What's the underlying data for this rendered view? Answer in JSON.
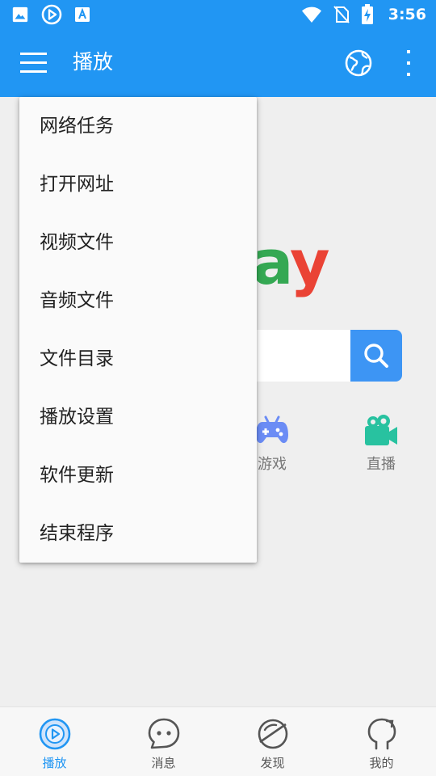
{
  "status_bar": {
    "time": "3:56",
    "left_icons": [
      "image-icon",
      "play-circle-icon",
      "font-download-icon"
    ],
    "right_icons": [
      "wifi-icon",
      "no-sim-icon",
      "battery-charging-icon"
    ]
  },
  "app_bar": {
    "title": "播放"
  },
  "logo": {
    "part1": "a",
    "part2": "y"
  },
  "search": {
    "value": "",
    "placeholder": ""
  },
  "categories": [
    {
      "label": "游戏",
      "icon": "gamepad-icon",
      "color": "#6b8cf5"
    },
    {
      "label": "直播",
      "icon": "video-camera-icon",
      "color": "#28c2a0"
    }
  ],
  "dropdown_menu": {
    "items": [
      {
        "label": "网络任务"
      },
      {
        "label": "打开网址"
      },
      {
        "label": "视频文件"
      },
      {
        "label": "音频文件"
      },
      {
        "label": "文件目录"
      },
      {
        "label": "播放设置"
      },
      {
        "label": "软件更新"
      },
      {
        "label": "结束程序"
      }
    ]
  },
  "bottom_nav": {
    "items": [
      {
        "label": "播放",
        "active": true,
        "icon": "play-circle-icon"
      },
      {
        "label": "消息",
        "active": false,
        "icon": "chat-bubble-icon"
      },
      {
        "label": "发现",
        "active": false,
        "icon": "planet-icon"
      },
      {
        "label": "我的",
        "active": false,
        "icon": "profile-icon"
      }
    ]
  },
  "colors": {
    "primary": "#2196f3",
    "search_button": "#3d95f4",
    "logo_green": "#34a853",
    "logo_red": "#ea4335"
  }
}
